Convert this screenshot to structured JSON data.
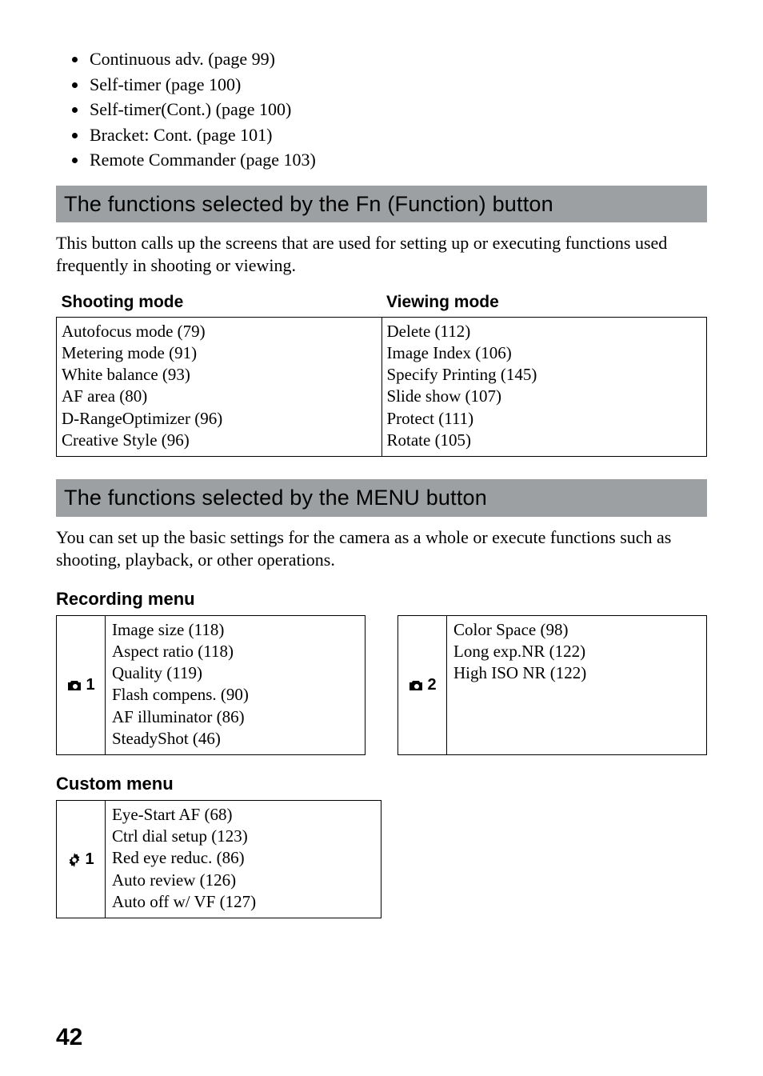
{
  "drive_bullets": [
    "Continuous adv. (page 99)",
    "Self-timer (page 100)",
    "Self-timer(Cont.) (page 100)",
    "Bracket: Cont. (page 101)",
    "Remote Commander (page 103)"
  ],
  "fn_section": {
    "title": "The functions selected by the Fn (Function) button",
    "intro": "This button calls up the screens that are used for setting up or executing functions used frequently in shooting or viewing.",
    "shooting_header": "Shooting mode",
    "viewing_header": "Viewing mode",
    "shooting_items": [
      "Autofocus mode (79)",
      "Metering mode (91)",
      "White balance (93)",
      "AF area (80)",
      "D-RangeOptimizer (96)",
      "Creative Style (96)"
    ],
    "viewing_items": [
      "Delete (112)",
      "Image Index (106)",
      "Specify Printing (145)",
      "Slide show (107)",
      "Protect (111)",
      "Rotate (105)"
    ]
  },
  "menu_section": {
    "title": "The functions selected by the MENU button",
    "intro": "You can set up the basic settings for the camera as a whole or execute functions such as shooting, playback, or other operations.",
    "recording_heading": "Recording menu",
    "recording_tab1_icon": "camera-icon",
    "recording_tab1_num": "1",
    "recording_tab1_items": [
      "Image size (118)",
      "Aspect ratio (118)",
      "Quality (119)",
      "Flash compens. (90)",
      "AF illuminator (86)",
      "SteadyShot (46)"
    ],
    "recording_tab2_icon": "camera-icon",
    "recording_tab2_num": "2",
    "recording_tab2_items": [
      "Color Space (98)",
      "Long exp.NR (122)",
      "High ISO NR (122)"
    ],
    "custom_heading": "Custom menu",
    "custom_tab1_icon": "gear-icon",
    "custom_tab1_num": "1",
    "custom_tab1_items": [
      "Eye-Start AF (68)",
      "Ctrl dial setup (123)",
      "Red eye reduc. (86)",
      "Auto review (126)",
      "Auto off w/ VF (127)"
    ]
  },
  "page_number": "42"
}
